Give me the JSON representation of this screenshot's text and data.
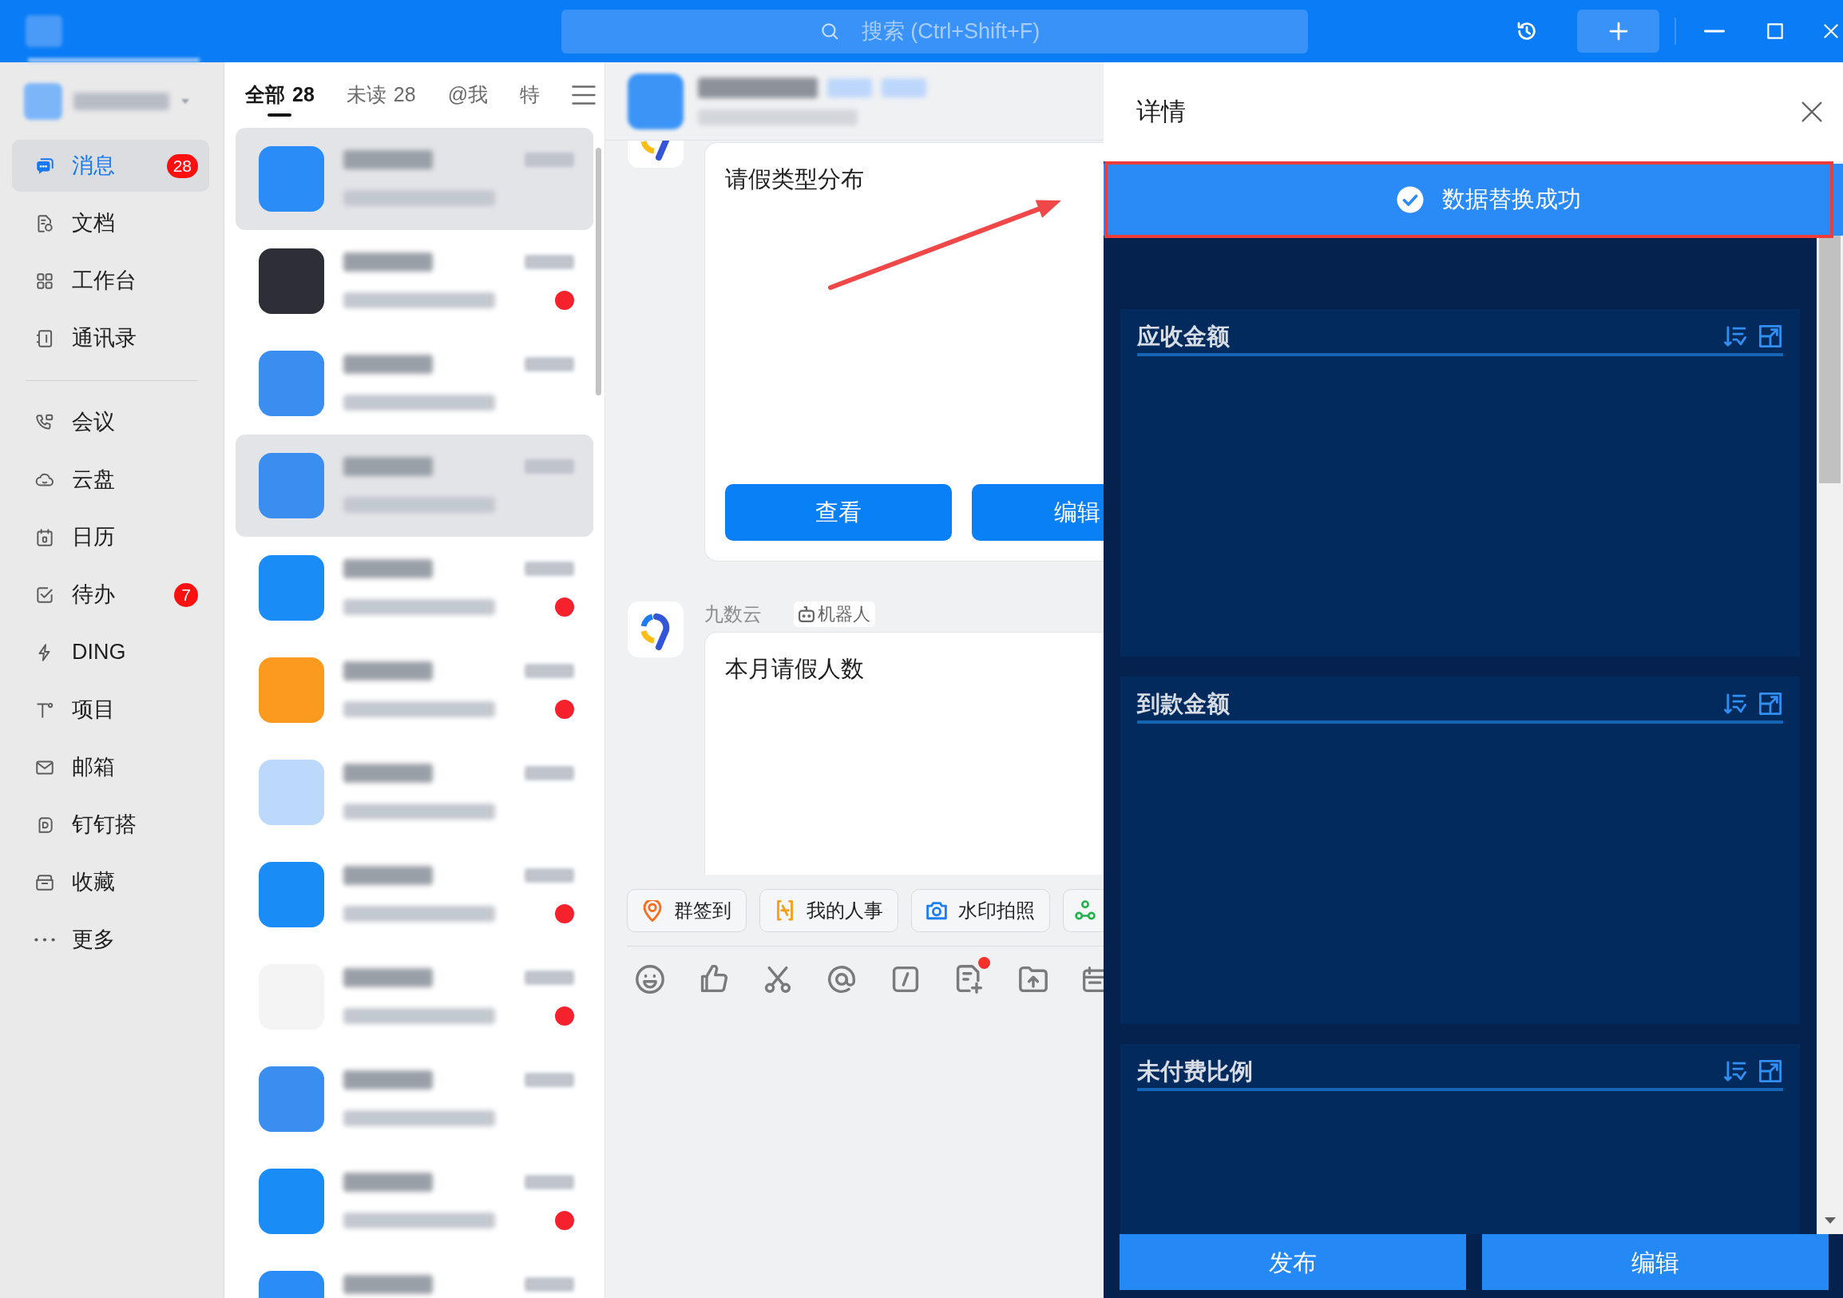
{
  "title_bar": {
    "search": {
      "placeholder": "搜索 (Ctrl+Shift+F)"
    }
  },
  "sidebar": {
    "sections": [
      {
        "items": [
          {
            "label": "消息",
            "selected": true,
            "badge": "28"
          },
          {
            "label": "文档",
            "selected": false
          },
          {
            "label": "工作台",
            "selected": false
          },
          {
            "label": "通讯录",
            "selected": false
          }
        ]
      },
      {
        "items": [
          {
            "label": "会议",
            "selected": false
          },
          {
            "label": "云盘",
            "selected": false
          },
          {
            "label": "日历",
            "selected": false
          },
          {
            "label": "待办",
            "selected": false,
            "badge": "7"
          },
          {
            "label": "DING",
            "selected": false
          },
          {
            "label": "项目",
            "selected": false
          },
          {
            "label": "邮箱",
            "selected": false
          },
          {
            "label": "钉钉搭",
            "selected": false
          },
          {
            "label": "收藏",
            "selected": false
          },
          {
            "label": "更多",
            "selected": false
          }
        ]
      }
    ]
  },
  "chat_list": {
    "tabs": [
      {
        "label": "全部",
        "count": "28",
        "selected": true
      },
      {
        "label": "未读",
        "count": "28",
        "selected": false
      },
      {
        "label": "@我",
        "selected": false
      },
      {
        "label": "特",
        "selected": false
      }
    ],
    "conversations": [
      {
        "selected": true,
        "unread": false,
        "color": "#2a8cf7"
      },
      {
        "selected": false,
        "unread": true,
        "color": "#2e2f36"
      },
      {
        "selected": false,
        "unread": false,
        "color": "#3a8ef0"
      },
      {
        "selected": true,
        "unread": false,
        "color": "#3a8ef0"
      },
      {
        "selected": false,
        "unread": true,
        "color": "#1a8cf5"
      },
      {
        "selected": false,
        "unread": true,
        "color": "#fa9a1e"
      },
      {
        "selected": false,
        "unread": false,
        "color": "#bcd9fb"
      },
      {
        "selected": false,
        "unread": true,
        "color": "#1a8cf5"
      },
      {
        "selected": false,
        "unread": true,
        "color": "#f4f4f4"
      },
      {
        "selected": false,
        "unread": false,
        "color": "#3a8ef0"
      },
      {
        "selected": false,
        "unread": true,
        "color": "#1a8cf5"
      },
      {
        "selected": false,
        "unread": false,
        "color": "#2a8cf7"
      }
    ]
  },
  "chat": {
    "messages": [
      {
        "title": "请假类型分布",
        "buttons": [
          "查看",
          "编辑"
        ]
      },
      {
        "sender": "九数云",
        "tag": "机器人",
        "title": "本月请假人数"
      }
    ],
    "quick_actions": [
      "群签到",
      "我的人事",
      "水印拍照"
    ],
    "toolbar": [
      {
        "dot": false
      },
      {
        "dot": false
      },
      {
        "dot": false
      },
      {
        "dot": false
      },
      {
        "dot": false
      },
      {
        "dot": true
      },
      {
        "dot": false
      },
      {
        "dot": false
      }
    ]
  },
  "details": {
    "title": "详情",
    "toast": "数据替换成功",
    "dashboard": {
      "cards": [
        {
          "title": "应收金额"
        },
        {
          "title": "到款金额"
        },
        {
          "title": "未付费比例"
        }
      ]
    },
    "buttons": [
      "发布",
      "编辑"
    ]
  }
}
